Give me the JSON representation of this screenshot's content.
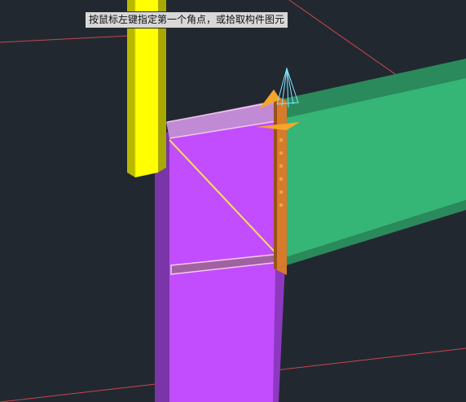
{
  "viewport": {
    "background": "#222830",
    "grid_line_color": "#c8474f"
  },
  "tooltip": {
    "text": "按鼠标左键指定第一个角点，或拾取构件图元"
  },
  "members": {
    "column": {
      "color": "#ffff00"
    },
    "column_web": {
      "color": "#c24dff"
    },
    "beam_flange": {
      "color": "#35b576"
    },
    "end_plate": {
      "color": "#d77a2a"
    },
    "stiffener_outline": {
      "color": "#f4c6ec"
    },
    "diagonal_stiffener": {
      "color": "#ffe34d"
    }
  },
  "gizmo": {
    "icon": "axis-cone-gizmo-icon",
    "color": "#7ee6ff",
    "arrow_color": "#f4a62a"
  }
}
